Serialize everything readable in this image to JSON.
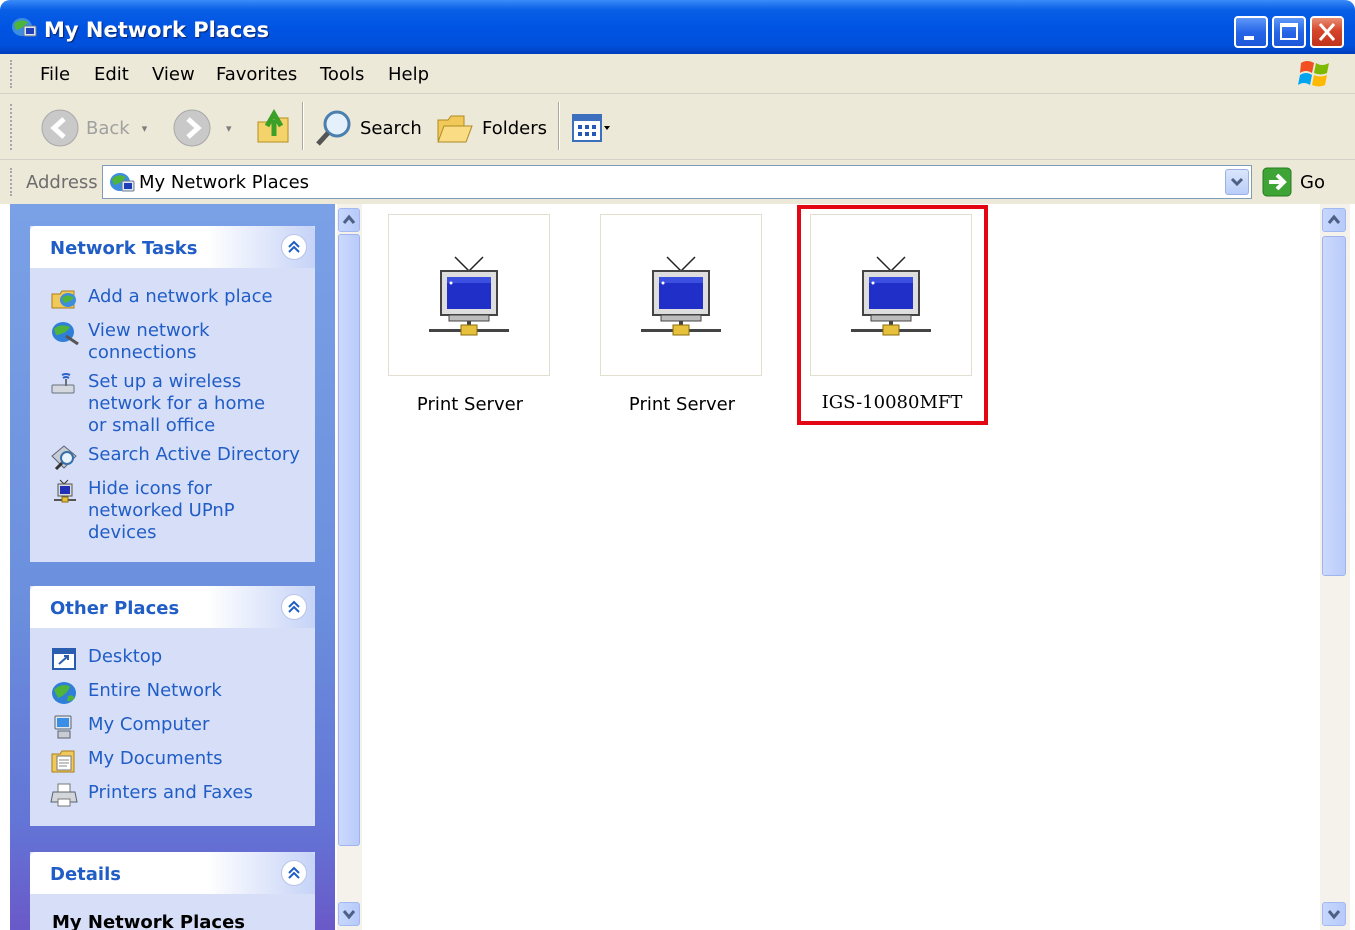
{
  "window": {
    "title": "My Network Places"
  },
  "menu": [
    "File",
    "Edit",
    "View",
    "Favorites",
    "Tools",
    "Help"
  ],
  "toolbar": {
    "back_label": "Back",
    "search_label": "Search",
    "folders_label": "Folders"
  },
  "address": {
    "label": "Address",
    "value": "My Network Places",
    "go_label": "Go"
  },
  "panels": {
    "network_tasks": {
      "title": "Network Tasks",
      "items": [
        {
          "label": "Add a network place",
          "icon": "add-network-place-icon"
        },
        {
          "label": "View network connections",
          "icon": "network-connections-icon"
        },
        {
          "label": "Set up a wireless network for a home or small office",
          "icon": "wireless-network-icon"
        },
        {
          "label": "Search Active Directory",
          "icon": "search-directory-icon"
        },
        {
          "label": "Hide icons for networked UPnP devices",
          "icon": "upnp-device-icon"
        }
      ]
    },
    "other_places": {
      "title": "Other Places",
      "items": [
        {
          "label": "Desktop",
          "icon": "desktop-icon"
        },
        {
          "label": "Entire Network",
          "icon": "globe-icon"
        },
        {
          "label": "My Computer",
          "icon": "computer-icon"
        },
        {
          "label": "My Documents",
          "icon": "documents-icon"
        },
        {
          "label": "Printers and Faxes",
          "icon": "printer-icon"
        }
      ]
    },
    "details": {
      "title": "Details",
      "name": "My Network Places"
    }
  },
  "items": [
    {
      "label": "Print Server",
      "icon": "upnp-device-icon"
    },
    {
      "label": "Print Server",
      "icon": "upnp-device-icon"
    },
    {
      "label": "IGS-10080MFT",
      "icon": "upnp-device-icon",
      "highlighted": true
    }
  ],
  "colors": {
    "titlebar": "#0054e3",
    "task_link": "#215dc6",
    "highlight_border": "#e30613",
    "panel_bg": "#7aa1e6"
  }
}
